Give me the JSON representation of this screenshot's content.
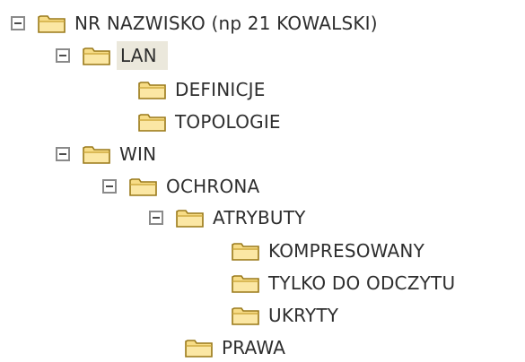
{
  "tree": {
    "root": {
      "label": "NR NAZWISKO (np 21 KOWALSKI)",
      "expanded": true
    },
    "lan": {
      "label": "LAN",
      "expanded": true,
      "selected": true
    },
    "definicje": {
      "label": "DEFINICJE"
    },
    "topologie": {
      "label": "TOPOLOGIE"
    },
    "win": {
      "label": "WIN",
      "expanded": true
    },
    "ochrona": {
      "label": "OCHRONA",
      "expanded": true
    },
    "atrybuty": {
      "label": "ATRYBUTY",
      "expanded": true
    },
    "kompresowany": {
      "label": "KOMPRESOWANY"
    },
    "tylko_do_odczytu": {
      "label": "TYLKO DO ODCZYTU"
    },
    "ukryty": {
      "label": "UKRYTY"
    },
    "prawa": {
      "label": "PRAWA"
    }
  },
  "icons": {
    "toggle": "minus-box-icon",
    "folder": "folder-icon"
  },
  "colors": {
    "folder_fill": "#f5d87a",
    "folder_outline": "#9a7a1c",
    "selection_bg": "#ebe8dc",
    "text": "#2e2e2e"
  }
}
